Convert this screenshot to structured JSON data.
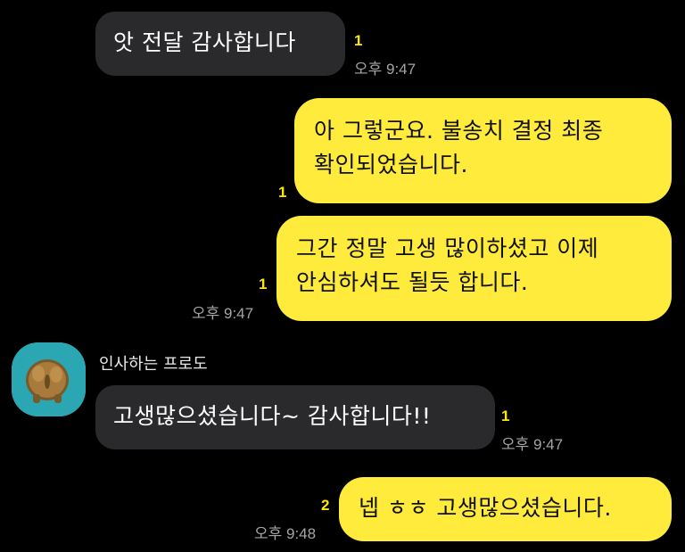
{
  "messages": [
    {
      "side": "in",
      "text": "앗 전달 감사합니다",
      "unread": "1",
      "time": "오후 9:47"
    },
    {
      "side": "out",
      "text": "아 그렇군요. 불송치 결정 최종\n확인되었습니다.",
      "unread": "1"
    },
    {
      "side": "out",
      "text": "그간 정말 고생 많이하셨고 이제\n안심하셔도 될듯 합니다.",
      "unread": "1",
      "time": "오후 9:47"
    },
    {
      "side": "in",
      "sender": "인사하는 프로도",
      "text": "고생많으셨습니다~ 감사합니다!!",
      "unread": "1",
      "time": "오후 9:47"
    },
    {
      "side": "out",
      "text": "넵 ㅎㅎ 고생많으셨습니다.",
      "unread": "2",
      "time": "오후 9:48"
    }
  ],
  "colors": {
    "background": "#000000",
    "incoming_bubble": "#2a2a2c",
    "outgoing_bubble": "#ffeb3b",
    "unread": "#ffe600",
    "time": "#a5a5a5",
    "avatar_bg": "#2aa7b3"
  },
  "icons": {
    "avatar": "frodo-bear-character-icon"
  }
}
